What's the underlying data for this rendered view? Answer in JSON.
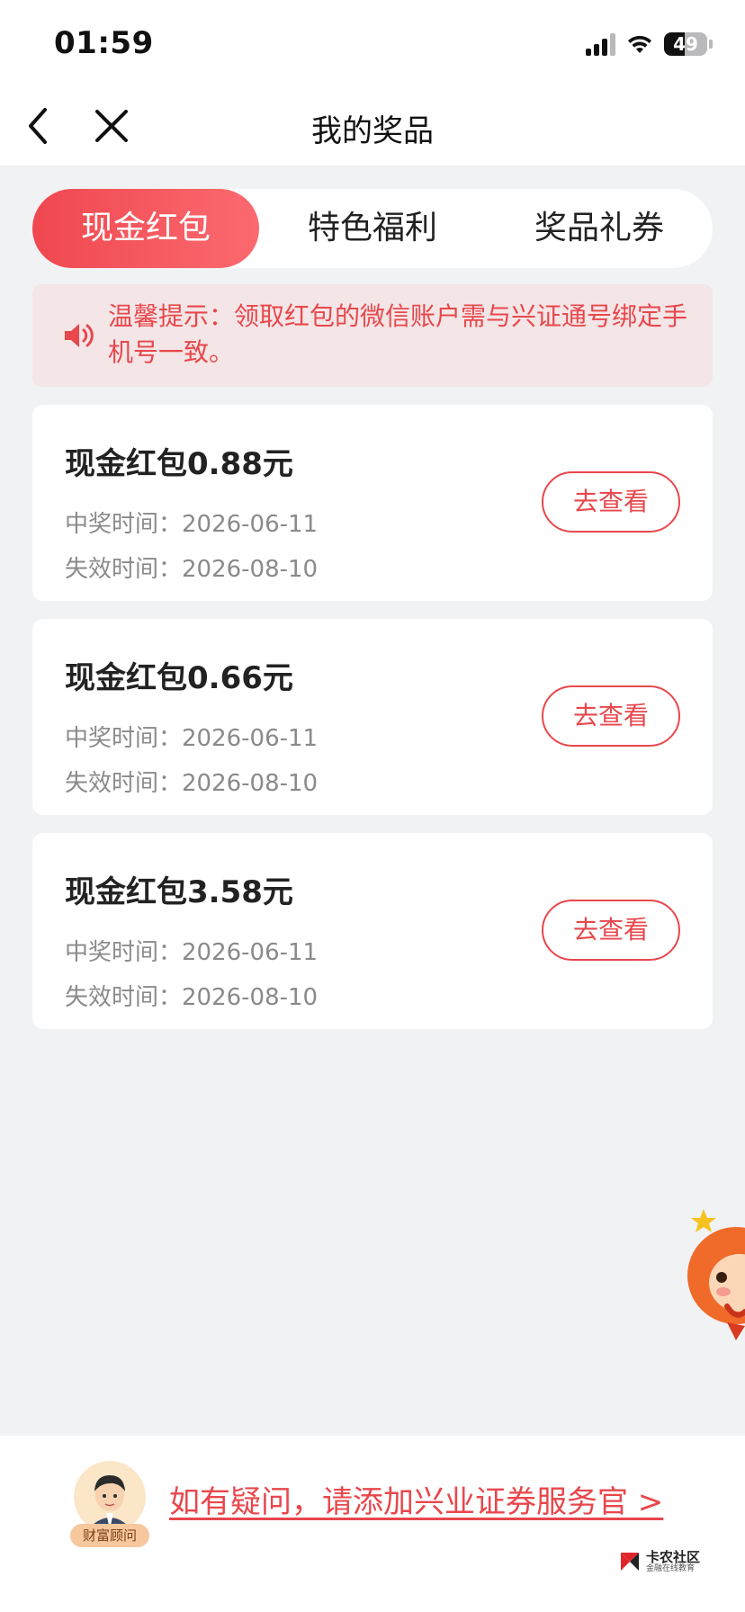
{
  "status_bar": {
    "time": "01:59",
    "battery": "49"
  },
  "nav": {
    "title": "我的奖品"
  },
  "tabs": [
    {
      "label": "现金红包",
      "active": true
    },
    {
      "label": "特色福利",
      "active": false
    },
    {
      "label": "奖品礼券",
      "active": false
    }
  ],
  "notice": {
    "text": "温馨提示：领取红包的微信账户需与兴证通号绑定手机号一致。"
  },
  "cards": [
    {
      "title": "现金红包0.88元",
      "win_time": "中奖时间：2026-06-11",
      "expire_time": "失效时间：2026-08-10",
      "button": "去查看"
    },
    {
      "title": "现金红包0.66元",
      "win_time": "中奖时间：2026-06-11",
      "expire_time": "失效时间：2026-08-10",
      "button": "去查看"
    },
    {
      "title": "现金红包3.58元",
      "win_time": "中奖时间：2026-06-11",
      "expire_time": "失效时间：2026-08-10",
      "button": "去查看"
    }
  ],
  "footer": {
    "advisor_badge": "财富顾问",
    "help_text": "如有疑问，请添加兴业证券服务官 >"
  },
  "watermark": {
    "title": "卡农社区",
    "subtitle": "金融在线教育"
  },
  "icons": {
    "back": "chevron-left-icon",
    "close": "close-icon",
    "notice": "speaker-icon",
    "mascot": "mascot-icon",
    "advisor": "advisor-avatar-icon"
  },
  "colors": {
    "accent": "#e8474c",
    "accent_light": "#fb6a70",
    "notice_bg": "#f4e5e6",
    "page_bg": "#f1f2f4"
  }
}
